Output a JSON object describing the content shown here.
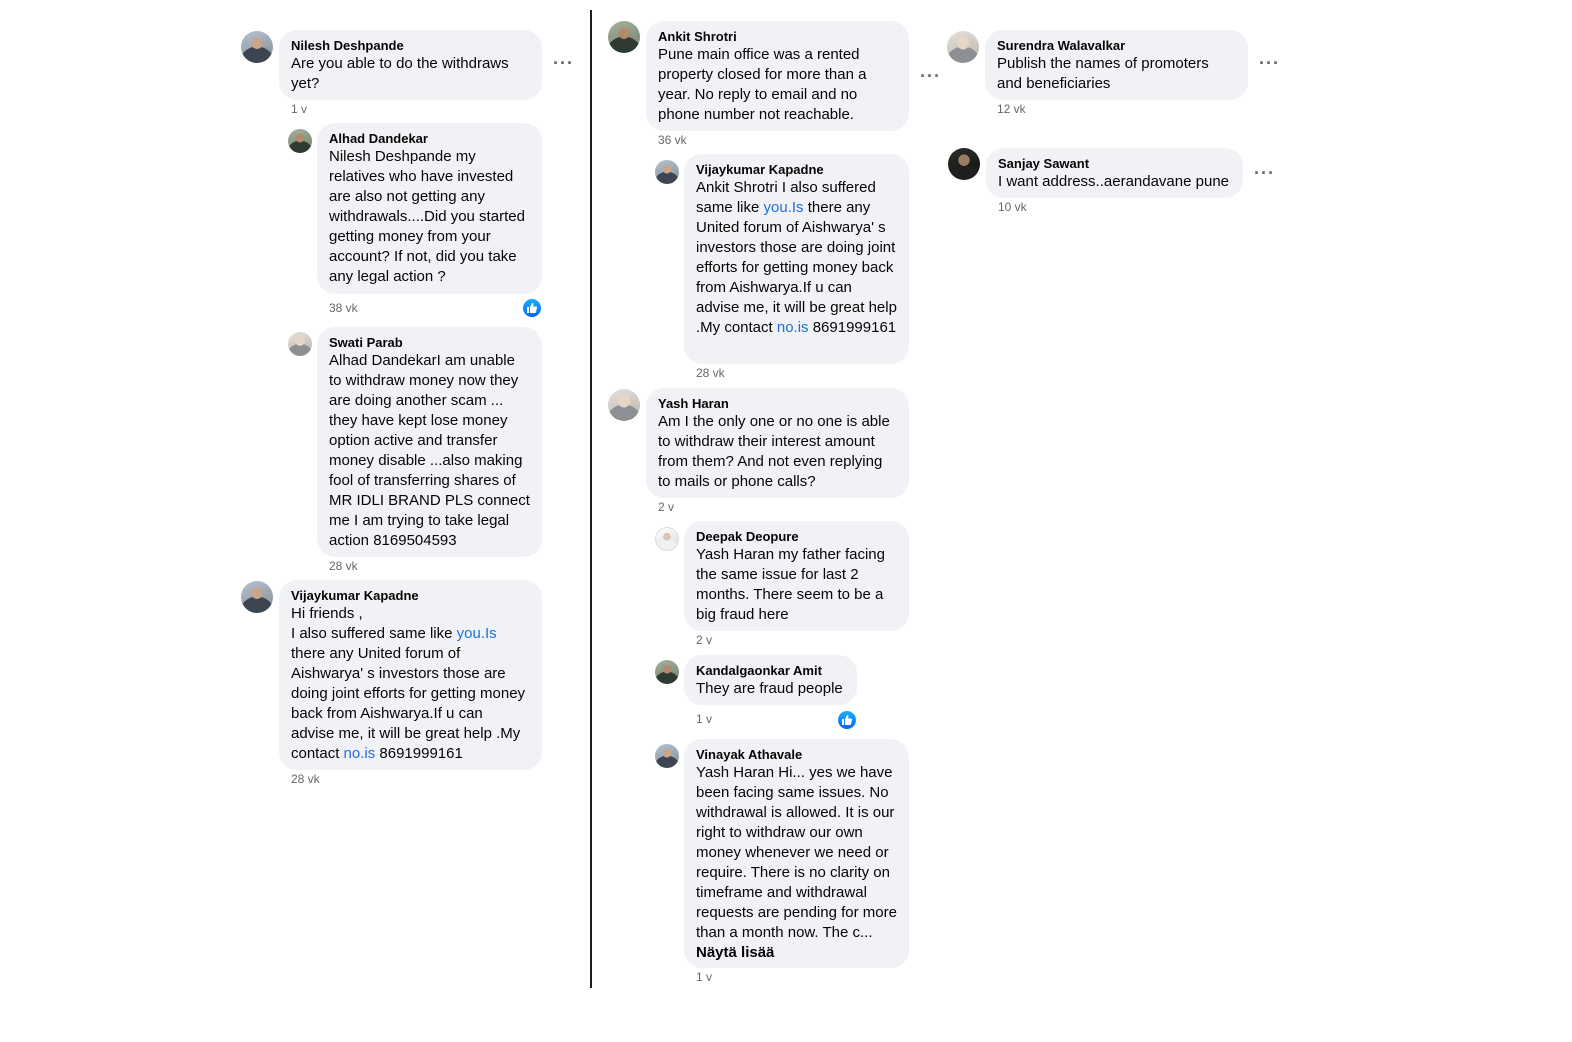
{
  "column1": {
    "nilesh": {
      "author": "Nilesh Deshpande",
      "text": "Are you able to do the withdraws yet?",
      "time": "1 v"
    },
    "alhad": {
      "author": "Alhad Dandekar",
      "text": "Nilesh Deshpande my relatives who have invested are also not getting any withdrawals....Did you started getting money from your account? If not, did you take any legal action ?",
      "time": "38 vk"
    },
    "swati": {
      "author": "Swati Parab",
      "text": "Alhad DandekarI am unable to withdraw money now they are doing another scam ... they have kept lose money option active and transfer money disable ...also making fool of transferring shares of MR IDLI BRAND PLS connect me I am trying to take legal action 8169504593",
      "time": "28 vk"
    },
    "vijay": {
      "author": "Vijaykumar Kapadne",
      "text_a": "Hi friends ,\nI also suffered same like ",
      "link_a": "you.Is",
      "text_b": "\nthere any United forum of Aishwarya' s investors those are doing joint efforts for getting money back from Aishwarya.If u can advise me, it will be great help .My contact ",
      "link_b": "no.is",
      "text_c": " 8691999161",
      "time": "28 vk"
    }
  },
  "column2": {
    "ankit": {
      "author": "Ankit Shrotri",
      "text": "Pune main office was a rented property closed for more than a year. No reply to email and no phone number not reachable.",
      "time": "36 vk"
    },
    "vijay2": {
      "author": "Vijaykumar Kapadne",
      "text_a": "Ankit Shrotri I also suffered same like ",
      "link_a": "you.Is",
      "text_b": " there any United forum of Aishwarya' s investors those are doing joint efforts for getting money back from Aishwarya.If u can advise me, it will be great help .My contact ",
      "link_b": "no.is",
      "text_c": " 8691999161",
      "time": "28 vk"
    },
    "yash": {
      "author": "Yash Haran",
      "text": "Am I the only one or no one is able to withdraw their interest amount from them? And not even replying to mails or phone calls?",
      "time": "2 v"
    },
    "deepak": {
      "author": "Deepak Deopure",
      "text": "Yash Haran my father facing the same issue for last 2 months. There seem to be a big fraud here",
      "time": "2 v"
    },
    "kandal": {
      "author": "Kandalgaonkar Amit",
      "text": "They are fraud people",
      "time": "1 v"
    },
    "vinayak": {
      "author": "Vinayak Athavale",
      "text": "Yash Haran Hi... yes we have been facing same issues. No withdrawal is allowed. It is our right to withdraw our own money whenever we need or require. There is no clarity on timeframe and withdrawal requests are pending for more than a month now. The c... ",
      "see_more": "Näytä lisää",
      "time": "1 v"
    }
  },
  "column3": {
    "surendra": {
      "author": "Surendra Walavalkar",
      "text": "Publish the names of promoters and beneficiaries",
      "time": "12 vk"
    },
    "sanjay": {
      "author": "Sanjay Sawant",
      "text": "I want address..aerandavane pune",
      "time": "10 vk"
    }
  },
  "icons": {
    "more": "more-options-icon",
    "like": "like-reaction-icon"
  },
  "colors": {
    "bubble": "#f0f2f5",
    "link": "#216fdb",
    "meta": "#65676b",
    "like": "#0866ff"
  }
}
